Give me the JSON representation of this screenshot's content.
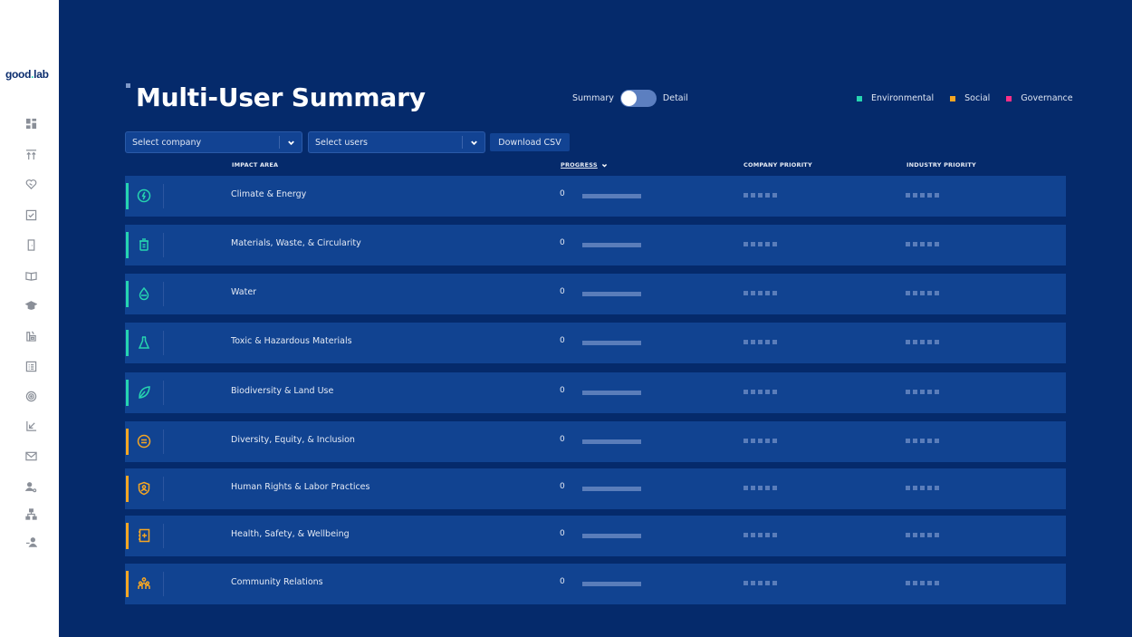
{
  "app": {
    "logo_text_1": "good",
    "logo_dot": ".",
    "logo_text_2": "lab"
  },
  "sidebar": {
    "items": [
      {
        "name": "dashboard",
        "icon": "dashboard-icon"
      },
      {
        "name": "goals",
        "icon": "arrows-up-icon"
      },
      {
        "name": "values",
        "icon": "heart-handshake-icon"
      },
      {
        "name": "tasks",
        "icon": "checkbox-icon"
      },
      {
        "name": "door",
        "icon": "door-icon"
      },
      {
        "name": "library",
        "icon": "book-open-icon"
      },
      {
        "name": "learning",
        "icon": "graduation-cap-icon"
      },
      {
        "name": "companies",
        "icon": "factory-icon"
      },
      {
        "name": "reports",
        "icon": "list-icon"
      },
      {
        "name": "targets",
        "icon": "target-icon"
      },
      {
        "name": "import",
        "icon": "arrow-in-icon"
      },
      {
        "name": "messages",
        "icon": "mail-icon"
      },
      {
        "name": "user-settings",
        "icon": "user-gear-icon"
      },
      {
        "name": "org-chart",
        "icon": "hierarchy-icon"
      },
      {
        "name": "invite-user",
        "icon": "user-add-icon"
      }
    ]
  },
  "header": {
    "title": "Multi-User Summary",
    "toggle": {
      "left_label": "Summary",
      "right_label": "Detail",
      "selected": "Summary"
    },
    "legend": [
      {
        "label": "Environmental",
        "color": "#26d4b0"
      },
      {
        "label": "Social",
        "color": "#f5a623"
      },
      {
        "label": "Governance",
        "color": "#ff2f86"
      }
    ]
  },
  "filters": {
    "company": {
      "placeholder": "Select company"
    },
    "users": {
      "placeholder": "Select users"
    },
    "download_label": "Download CSV"
  },
  "table": {
    "columns": {
      "impact_area": "IMPACT AREA",
      "progress": "PROGRESS",
      "company_priority": "COMPANY PRIORITY",
      "industry_priority": "INDUSTRY PRIORITY"
    },
    "rows": [
      {
        "name": "Climate & Energy",
        "category": "Environmental",
        "icon": "lightning-circle-icon",
        "progress": 0,
        "company_priority": 0,
        "industry_priority": 0
      },
      {
        "name": "Materials, Waste, & Circularity",
        "category": "Environmental",
        "icon": "recycle-bin-icon",
        "progress": 0,
        "company_priority": 0,
        "industry_priority": 0
      },
      {
        "name": "Water",
        "category": "Environmental",
        "icon": "water-drop-icon",
        "progress": 0,
        "company_priority": 0,
        "industry_priority": 0
      },
      {
        "name": "Toxic & Hazardous Materials",
        "category": "Environmental",
        "icon": "flask-icon",
        "progress": 0,
        "company_priority": 0,
        "industry_priority": 0
      },
      {
        "name": "Biodiversity & Land Use",
        "category": "Environmental",
        "icon": "leaf-icon",
        "progress": 0,
        "company_priority": 0,
        "industry_priority": 0
      },
      {
        "name": "Diversity, Equity, & Inclusion",
        "category": "Social",
        "icon": "equals-circle-icon",
        "progress": 0,
        "company_priority": 0,
        "industry_priority": 0
      },
      {
        "name": "Human Rights & Labor Practices",
        "category": "Social",
        "icon": "shield-user-icon",
        "progress": 0,
        "company_priority": 0,
        "industry_priority": 0
      },
      {
        "name": "Health, Safety, & Wellbeing",
        "category": "Social",
        "icon": "medical-book-icon",
        "progress": 0,
        "company_priority": 0,
        "industry_priority": 0
      },
      {
        "name": "Community Relations",
        "category": "Social",
        "icon": "community-icon",
        "progress": 0,
        "company_priority": 0,
        "industry_priority": 0
      }
    ]
  }
}
